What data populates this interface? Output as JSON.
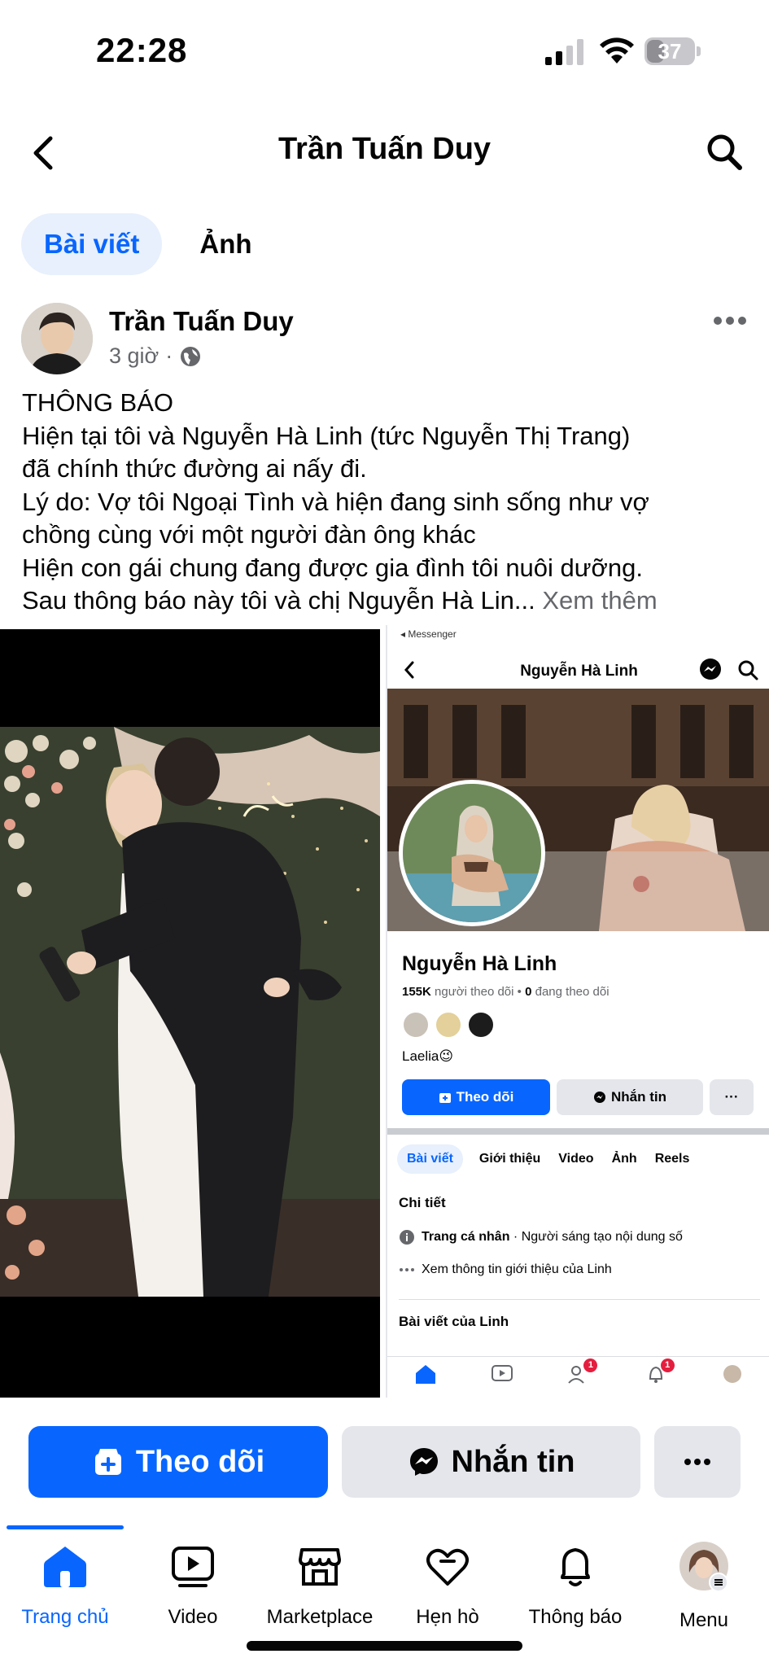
{
  "status_bar": {
    "time": "22:28",
    "battery": "37",
    "battery_level": 0.37
  },
  "header": {
    "title": "Trần Tuấn Duy"
  },
  "tabs": [
    {
      "label": "Bài viết",
      "active": true
    },
    {
      "label": "Ảnh",
      "active": false
    }
  ],
  "post": {
    "author": "Trần Tuấn Duy",
    "time": "3 giờ",
    "separator": "·",
    "lines": [
      "THÔNG BÁO",
      "Hiện tại tôi và Nguyễn Hà Linh (tức Nguyễn Thị Trang)",
      "đã chính thức đường ai nấy đi.",
      "Lý do: Vợ tôi Ngoại Tình và hiện đang sinh sống như vợ",
      "chồng cùng với một người đàn ông khác",
      "Hiện con gái chung đang được gia đình tôi nuôi dưỡng."
    ],
    "last_line": "Sau thông báo này tôi và chị Nguyễn Hà Lin...",
    "see_more": "Xem thêm"
  },
  "inner_screenshot": {
    "top_label": "◂ Messenger",
    "title": "Nguyễn Hà Linh",
    "name": "Nguyễn Hà Linh",
    "followers_count": "155K",
    "followers_text": "người theo dõi",
    "dot": "•",
    "following_count": "0",
    "following_text": "đang theo dõi",
    "bio": "Laelia😉",
    "follow_label": "Theo dõi",
    "message_label": "Nhắn tin",
    "more_label": "···",
    "tabs": [
      "Bài viết",
      "Giới thiệu",
      "Video",
      "Ảnh",
      "Reels"
    ],
    "details_heading": "Chi tiết",
    "detail_bold": "Trang cá nhân",
    "detail_rest": " · Người sáng tạo nội dung số",
    "about_link": "Xem thông tin giới thiệu của Linh",
    "posts_heading": "Bài viết của Linh",
    "badge_friends": "1",
    "badge_notifications": "1"
  },
  "actions": {
    "follow": "Theo dõi",
    "message": "Nhắn tin"
  },
  "bottom_nav": [
    {
      "label": "Trang chủ",
      "icon": "home-icon",
      "active": true
    },
    {
      "label": "Video",
      "icon": "video-icon",
      "active": false
    },
    {
      "label": "Marketplace",
      "icon": "marketplace-icon",
      "active": false
    },
    {
      "label": "Hẹn hò",
      "icon": "dating-heart-icon",
      "active": false
    },
    {
      "label": "Thông báo",
      "icon": "bell-icon",
      "active": false
    },
    {
      "label": "Menu",
      "icon": "menu-avatar-icon",
      "active": false
    }
  ],
  "colors": {
    "accent": "#0866ff",
    "secondary_text": "#65676b",
    "button_gray": "#e4e6eb",
    "badge": "#e41e3f"
  }
}
